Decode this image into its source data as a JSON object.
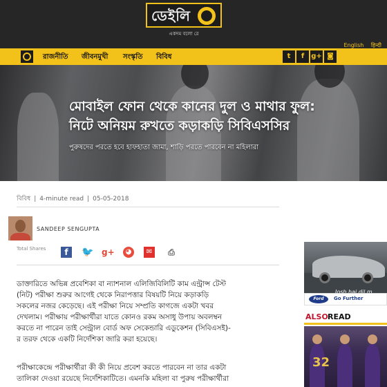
{
  "site": {
    "logo_text": "ডেইলি",
    "tagline": "একদম বলো রে",
    "lang_links": [
      "English",
      "हिन्दी"
    ]
  },
  "nav": {
    "items": [
      "রাজনীতি",
      "জীবনমুখী",
      "সংস্কৃতি",
      "বিবিধ"
    ],
    "social_icons": [
      "twitter-icon",
      "facebook-icon",
      "google-plus-icon",
      "instagram-icon"
    ],
    "accent_color": "#f2c21b"
  },
  "article": {
    "headline_line1": "মোবাইল ফোন থেকে কানের দুল ও মাথার ফুল:",
    "headline_line2": "নিটে অনিয়ম রুখতে কড়াকড়ি সিবিএসসির",
    "subheading": "পুরুষদের পরতে হবে হাফহাতা জামা, শাড়ি পরতে পারবেন না মহিলারা",
    "category": "বিবিধ",
    "read_time": "4-minute read",
    "date": "05-05-2018",
    "author": "SANDEEP SENGUPTA",
    "total_shares_label": "Total Shares",
    "share_icons": [
      "facebook-icon",
      "twitter-icon",
      "google-plus-icon",
      "reddit-icon",
      "email-icon",
      "print-icon"
    ],
    "paragraph1": [
      "ডাক্তারিতে অভিন্ন প্রবেশিকা বা ন্যাশনাল এলিজিবিলিটি কাম এন্ট্রান্স টেস্ট",
      "(নিট) পরীক্ষা শুরুর আগেই থেকে নিরাপত্তার বিষয়টি নিয়ে কড়াকড়ি",
      "সকলের নজর কেড়েছে। এই পরীক্ষা নিয়ে সম্প্রতি কাগজে একটা খবর",
      "দেখলাম। পরীক্ষায় পরীক্ষার্থীরা যাতে কোনও রকম অসাধু উপায় অবলম্বন",
      "করতে না পারেন তাই সেন্ট্রাল বোর্ড অফ সেকেন্ডারি এডুকেশন (সিবিএসই)-",
      "র তরফ থেকে একটি নির্দেশিকা জারি করা হয়েছে।"
    ],
    "paragraph2": [
      "পরীক্ষাকেন্দ্রে পরীক্ষার্থীরা কী কী নিয়ে প্রবেশ করতে পারবেন না তার একটা",
      "তালিকা দেওয়া রয়েছে নির্দেশিকাটিতে। এমনকি মহিলা বা পুরুষ পরীক্ষার্থীরা"
    ]
  },
  "sidebar": {
    "ad_tagline": "Josh hai dil m",
    "ad_brand": "Ford",
    "ad_cta": "Go Further",
    "also_read_1": "ALSO",
    "also_read_2": "READ",
    "thumb_jersey": "32"
  }
}
